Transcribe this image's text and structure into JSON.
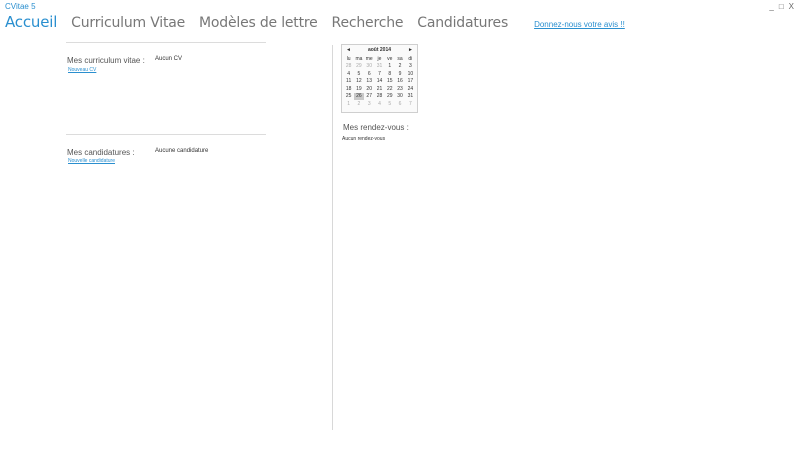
{
  "window": {
    "title": "CVitae 5",
    "controls": {
      "minimize": "_",
      "restore": "□",
      "close": "X"
    }
  },
  "nav": {
    "tabs": [
      {
        "label": "Accueil",
        "active": true
      },
      {
        "label": "Curriculum Vitae",
        "active": false
      },
      {
        "label": "Modèles de lettre",
        "active": false
      },
      {
        "label": "Recherche",
        "active": false
      },
      {
        "label": "Candidatures",
        "active": false
      }
    ],
    "feedback_link": "Donnez-nous votre avis !!"
  },
  "cv_section": {
    "label": "Mes curriculum vitae :",
    "value": "Aucun CV",
    "link": "Nouveau CV"
  },
  "applications_section": {
    "label": "Mes candidatures :",
    "value": "Aucune candidature",
    "link": "Nouvelle candidature"
  },
  "calendar": {
    "month_label": "août 2014",
    "prev": "◄",
    "next": "►",
    "weekdays": [
      "lu",
      "ma",
      "me",
      "je",
      "ve",
      "sa",
      "di"
    ],
    "weeks": [
      [
        "28",
        "29",
        "30",
        "31",
        "1",
        "2",
        "3"
      ],
      [
        "4",
        "5",
        "6",
        "7",
        "8",
        "9",
        "10"
      ],
      [
        "11",
        "12",
        "13",
        "14",
        "15",
        "16",
        "17"
      ],
      [
        "18",
        "19",
        "20",
        "21",
        "22",
        "23",
        "24"
      ],
      [
        "25",
        "26",
        "27",
        "28",
        "29",
        "30",
        "31"
      ],
      [
        "1",
        "2",
        "3",
        "4",
        "5",
        "6",
        "7"
      ]
    ],
    "today": "26"
  },
  "appointments": {
    "title": "Mes rendez-vous :",
    "empty_text": "Aucun rendez-vous"
  }
}
